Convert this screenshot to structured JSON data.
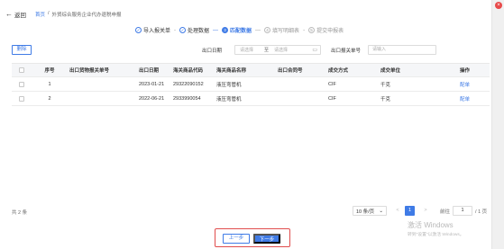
{
  "header": {
    "back_label": "返回",
    "breadcrumb": [
      "首页",
      "/",
      "外贸综合服务企业代办退税申报"
    ]
  },
  "steps": [
    {
      "num": "✓",
      "label": "导入报关单",
      "state": "done"
    },
    {
      "num": "✓",
      "label": "处理数据",
      "state": "done"
    },
    {
      "num": "3",
      "label": "匹配数据",
      "state": "active"
    },
    {
      "num": "4",
      "label": "填写明细表",
      "state": "todo"
    },
    {
      "num": "5",
      "label": "提交申报表",
      "state": "todo"
    }
  ],
  "step_separators": [
    "-",
    "—",
    "—",
    "-"
  ],
  "filters": {
    "delete_label": "删除",
    "date_label": "出口日期",
    "start_placeholder": "请选择",
    "to_label": "至",
    "end_placeholder": "请选择",
    "declaration_label": "出口报关单号",
    "declaration_placeholder": "请输入"
  },
  "table": {
    "columns": [
      "序号",
      "出口货物报关单号",
      "出口日期",
      "海关商品代码",
      "海关商品名称",
      "出口合同号",
      "成交方式",
      "成交单位",
      "操作"
    ],
    "rows": [
      {
        "index": "1",
        "declaration_no": "",
        "export_date": "2023-01-21",
        "hs_code": "29322090152",
        "hs_name": "液压弯管机",
        "contract_no": "",
        "deal_method": "CIF",
        "deal_unit": "千克",
        "action": "配单"
      },
      {
        "index": "2",
        "declaration_no": "",
        "export_date": "2022-06-21",
        "hs_code": "2933990054",
        "hs_name": "液压弯管机",
        "contract_no": "",
        "deal_method": "CIF",
        "deal_unit": "千克",
        "action": "配单"
      }
    ]
  },
  "pagination": {
    "total": "共 2 条",
    "page_size": "10 条/页",
    "prev": "<",
    "current": "1",
    "next": ">",
    "goto_label": "前往",
    "goto_value": "1",
    "total_pages": "/ 1 页"
  },
  "footer": {
    "prev_label": "上一步",
    "next_label": "下一步"
  },
  "watermark": {
    "line1": "激活 Windows",
    "line2": "转到\"设置\"以激活 Windows。"
  },
  "colors": {
    "accent": "#3f7be6",
    "highlight_frame": "#e04c4c"
  }
}
